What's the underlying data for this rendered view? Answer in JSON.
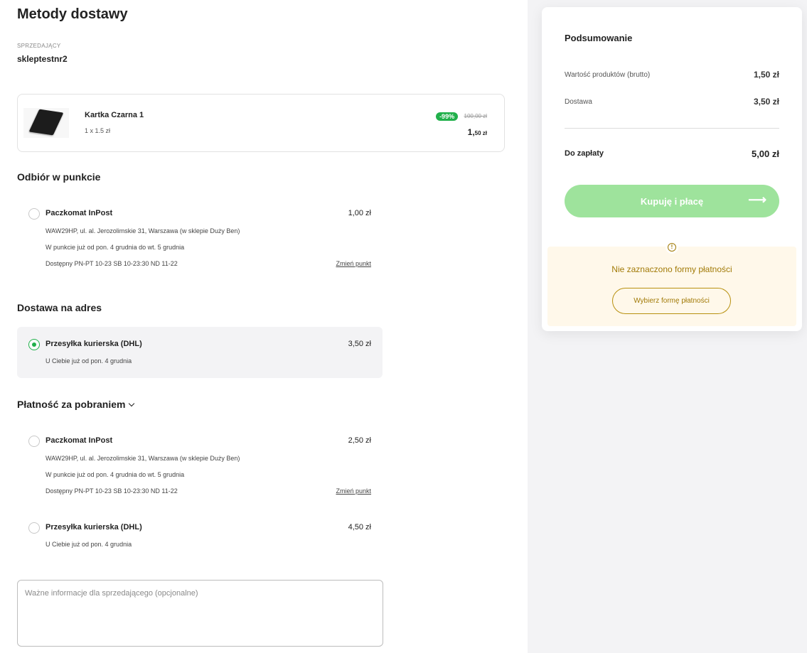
{
  "page": {
    "title": "Metody dostawy"
  },
  "seller": {
    "caption": "SPRZEDAJĄCY",
    "name": "skleptestnr2"
  },
  "product": {
    "name": "Kartka Czarna 1",
    "qty": "1 x 1.5 zł",
    "discount": "-99%",
    "old_price": "100,00 zł",
    "new_price_main": "1,",
    "new_price_rest": "50 zł"
  },
  "pickup": {
    "title": "Odbiór w punkcie",
    "options": [
      {
        "name": "Paczkomat InPost",
        "price": "1,00 zł",
        "address": "WAW29HP, ul. al. Jerozolimskie 31, Warszawa (w sklepie Duży Ben)",
        "eta": "W punkcie już od pon. 4 grudnia do wt. 5 grudnia",
        "hours": "Dostępny PN-PT 10-23 SB 10-23:30 ND 11-22",
        "link": "Zmień punkt"
      }
    ]
  },
  "address_delivery": {
    "title": "Dostawa na adres",
    "options": [
      {
        "name": "Przesyłka kurierska (DHL)",
        "price": "3,50 zł",
        "eta": "U Ciebie już od pon. 4 grudnia",
        "selected": true
      }
    ]
  },
  "cod": {
    "title": "Płatność za pobraniem",
    "options": [
      {
        "name": "Paczkomat InPost",
        "price": "2,50 zł",
        "address": "WAW29HP, ul. al. Jerozolimskie 31, Warszawa (w sklepie Duży Ben)",
        "eta": "W punkcie już od pon. 4 grudnia do wt. 5 grudnia",
        "hours": "Dostępny PN-PT 10-23 SB 10-23:30 ND 11-22",
        "link": "Zmień punkt"
      },
      {
        "name": "Przesyłka kurierska (DHL)",
        "price": "4,50 zł",
        "eta": "U Ciebie już od pon. 4 grudnia"
      }
    ]
  },
  "note": {
    "placeholder": "Ważne informacje dla sprzedającego (opcjonalne)"
  },
  "summary": {
    "title": "Podsumowanie",
    "products_label": "Wartość produktów (brutto)",
    "products_value": "1,50 zł",
    "delivery_label": "Dostawa",
    "delivery_value": "3,50 zł",
    "total_label": "Do zapłaty",
    "total_value": "5,00 zł",
    "buy_label": "Kupuję i płacę",
    "warning_text": "Nie zaznaczono formy płatności",
    "choose_payment_label": "Wybierz formę płatności"
  },
  "colors": {
    "accent_green": "#21b04b",
    "button_green": "#9ee39c",
    "warning_text": "#a27a07",
    "warning_bg": "#fff8ea"
  },
  "icons": {
    "radio": "radio-icon",
    "chevron": "chevron-down-icon",
    "arrow": "arrow-right-icon",
    "warning": "warning-icon"
  }
}
